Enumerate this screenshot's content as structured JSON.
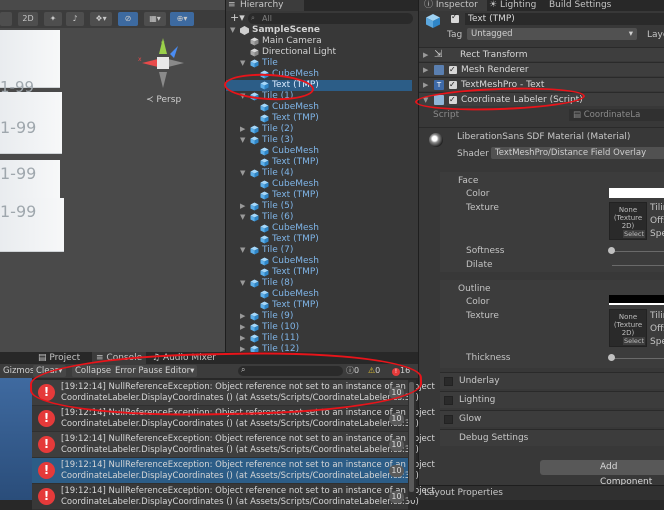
{
  "scene": {
    "toolbar": {
      "mode_2d": "2D"
    },
    "tile_text": "1-99",
    "persp_label": "Persp",
    "colors": {
      "axis_x": "#e84a4a",
      "axis_y": "#9ad04a",
      "axis_z": "#4a8cf2"
    }
  },
  "hierarchy": {
    "tab_label": "Hierarchy",
    "add_button": "+",
    "search_placeholder": "All",
    "items": [
      {
        "label": "SampleScene",
        "style": "scene"
      },
      {
        "label": "Main Camera",
        "style": "white"
      },
      {
        "label": "Directional Light",
        "style": "white"
      },
      {
        "label": "Tile",
        "style": "blue"
      },
      {
        "label": "CubeMesh",
        "style": "blue"
      },
      {
        "label": "Text (TMP)",
        "style": "blue",
        "selected": true
      },
      {
        "label": "Tile (1)",
        "style": "blue"
      },
      {
        "label": "CubeMesh",
        "style": "blue"
      },
      {
        "label": "Text (TMP)",
        "style": "blue"
      },
      {
        "label": "Tile (2)",
        "style": "blue"
      },
      {
        "label": "Tile (3)",
        "style": "blue"
      },
      {
        "label": "CubeMesh",
        "style": "blue"
      },
      {
        "label": "Text (TMP)",
        "style": "blue"
      },
      {
        "label": "Tile (4)",
        "style": "blue"
      },
      {
        "label": "CubeMesh",
        "style": "blue"
      },
      {
        "label": "Text (TMP)",
        "style": "blue"
      },
      {
        "label": "Tile (5)",
        "style": "blue"
      },
      {
        "label": "Tile (6)",
        "style": "blue"
      },
      {
        "label": "CubeMesh",
        "style": "blue"
      },
      {
        "label": "Text (TMP)",
        "style": "blue"
      },
      {
        "label": "Tile (7)",
        "style": "blue"
      },
      {
        "label": "CubeMesh",
        "style": "blue"
      },
      {
        "label": "Text (TMP)",
        "style": "blue"
      },
      {
        "label": "Tile (8)",
        "style": "blue"
      },
      {
        "label": "CubeMesh",
        "style": "blue"
      },
      {
        "label": "Text (TMP)",
        "style": "blue"
      },
      {
        "label": "Tile (9)",
        "style": "blue"
      },
      {
        "label": "Tile (10)",
        "style": "blue"
      },
      {
        "label": "Tile (11)",
        "style": "blue"
      },
      {
        "label": "Tile (12)",
        "style": "blue"
      }
    ]
  },
  "inspector": {
    "tabs": [
      "Inspector",
      "Lighting",
      "Build Settings"
    ],
    "object_name": "Text (TMP)",
    "tag_label": "Tag",
    "tag_value": "Untagged",
    "layer_label": "Laye",
    "components": [
      "Rect Transform",
      "Mesh Renderer",
      "TextMeshPro - Text",
      "Coordinate Labeler (Script)"
    ],
    "script_label": "Script",
    "script_value": "CoordinateLa",
    "material_name": "LiberationSans SDF Material (Material)",
    "shader_label": "Shader",
    "shader_value": "TextMeshPro/Distance Field Overlay",
    "face": {
      "title": "Face",
      "color_label": "Color",
      "texture_label": "Texture",
      "texture_box": [
        "None",
        "(Texture",
        "2D)"
      ],
      "select": "Select",
      "tiling": "Tilin",
      "offset": "Offs",
      "speed": "Spe",
      "softness": "Softness",
      "dilate": "Dilate"
    },
    "outline": {
      "title": "Outline",
      "color_label": "Color",
      "texture_label": "Texture",
      "texture_box": [
        "None",
        "(Texture",
        "2D)"
      ],
      "select": "Select",
      "tiling": "Tilin",
      "offset": "Offs",
      "speed": "Spe",
      "thickness": "Thickness"
    },
    "sections": [
      "Underlay",
      "Lighting",
      "Glow",
      "Debug Settings"
    ],
    "add_component": "Add Component",
    "layout_properties": "Layout Properties"
  },
  "console": {
    "tabs": [
      "Project",
      "Console",
      "Audio Mixer"
    ],
    "toolbar": [
      "Gizmos",
      "Clear",
      "Collapse",
      "Error Pause",
      "Editor"
    ],
    "badges": {
      "info": "0",
      "warn": "0",
      "error": "16"
    },
    "entries": [
      {
        "line1": "[19:12:14] NullReferenceException: Object reference not set to an instance of an object",
        "line2": "CoordinateLabeler.DisplayCoordinates () (at Assets/Scripts/CoordinateLabeler.cs:30)",
        "count": "10"
      },
      {
        "line1": "[19:12:14] NullReferenceException: Object reference not set to an instance of an object",
        "line2": "CoordinateLabeler.DisplayCoordinates () (at Assets/Scripts/CoordinateLabeler.cs:30)",
        "count": "10"
      },
      {
        "line1": "[19:12:14] NullReferenceException: Object reference not set to an instance of an object",
        "line2": "CoordinateLabeler.DisplayCoordinates () (at Assets/Scripts/CoordinateLabeler.cs:30)",
        "count": "10"
      },
      {
        "line1": "[19:12:14] NullReferenceException: Object reference not set to an instance of an object",
        "line2": "CoordinateLabeler.DisplayCoordinates () (at Assets/Scripts/CoordinateLabeler.cs:30)",
        "count": "10"
      },
      {
        "line1": "[19:12:14] NullReferenceException: Object reference not set to an instance of an object",
        "line2": "CoordinateLabeler.DisplayCoordinates () (at Assets/Scripts/CoordinateLabeler.cs:30)",
        "count": "10"
      }
    ]
  }
}
